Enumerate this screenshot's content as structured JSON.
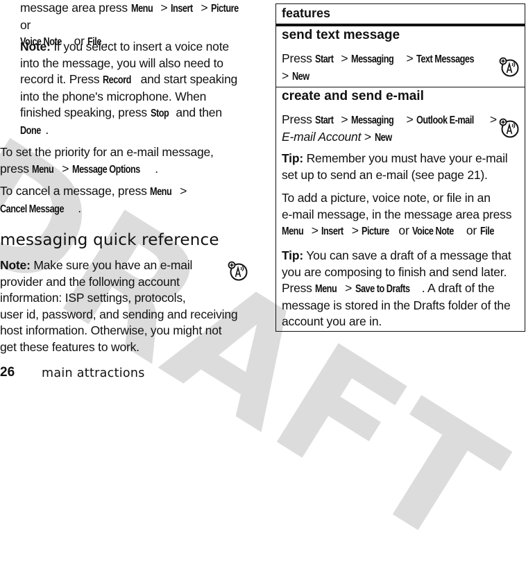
{
  "watermark": "DRAFT",
  "left_column": {
    "p1": {
      "prefix": "message area press ",
      "menu": "Menu",
      "sep": " > ",
      "insert": "Insert",
      "picture": "Picture",
      "or1": " or",
      "voice_note": "Voice Note",
      "or2": " or ",
      "file": "File",
      "end": "."
    },
    "note1": {
      "lead": "Note:",
      "line1": " If you select to insert a voice note",
      "line2": "into the message, you will also need to",
      "line3_a": "record it. Press ",
      "record": "Record",
      "line3_b": " and start speaking",
      "line4": "into the phone's microphone. When",
      "line5_a": "finished speaking, press ",
      "stop": "Stop",
      "line5_b": " and then",
      "done": "Done",
      "end": "."
    },
    "priority": {
      "line1": "To set the priority for an e-mail message,",
      "line2_a": "press ",
      "menu": "Menu",
      "sep": " > ",
      "message_options": "Message Options",
      "end": "."
    },
    "cancel": {
      "line1_a": "To cancel a message, press ",
      "menu": "Menu",
      "sep": " >",
      "cancel_message": "Cancel Message",
      "end": "."
    },
    "section_heading": "messaging quick reference",
    "note2": {
      "lead": "Note:",
      "line1": " Make sure you have an e-mail",
      "line2": "provider and the following account",
      "line3": "information: ISP settings, protocols,",
      "line4": "user id, password, and sending and receiving",
      "line5": "host information. Otherwise, you might not",
      "line6": "get these features to work."
    }
  },
  "footer": {
    "page_number": "26",
    "section": "main attractions"
  },
  "table": {
    "header": "features",
    "rows": [
      {
        "title": "send text message",
        "press": "Press ",
        "path": [
          "Start",
          "Messaging",
          "Text Messages",
          "New"
        ],
        "sep": " > "
      },
      {
        "title": "create and send e-mail",
        "press": "Press ",
        "path": [
          "Start",
          "Messaging",
          "Outlook E-mail",
          "E-mail Account",
          "New"
        ],
        "sep": " > ",
        "tip1_lead": "Tip:",
        "tip1_line1": " Remember you must have your e-mail",
        "tip1_line2": "set up to send an e-mail (see page 21).",
        "add_line1": "To add a picture, voice note, or file in an",
        "add_line2": "e-mail message, in the message area press",
        "add_menu": "Menu",
        "add_insert": "Insert",
        "add_picture": "Picture",
        "add_or": " or ",
        "add_voice_note": "Voice Note",
        "add_file": "File",
        "tip2_lead": "Tip:",
        "tip2_line1": " You can save a draft of a message that",
        "tip2_line2": "you are composing to finish and send later.",
        "tip2_line3_a": "Press ",
        "tip2_menu": "Menu",
        "tip2_save": "Save to Drafts",
        "tip2_line3_b": ". A draft of the",
        "tip2_line4": "message is stored in the Drafts folder of the",
        "tip2_line5": "account you are in."
      }
    ]
  },
  "icons": {
    "network_feature": "network-dependent-feature-icon"
  }
}
